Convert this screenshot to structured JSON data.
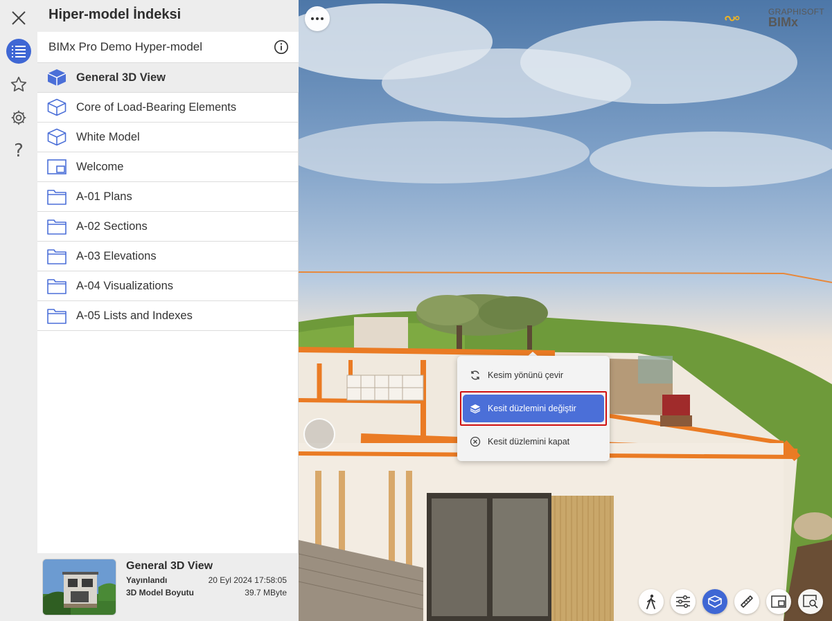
{
  "panel": {
    "title": "Hiper-model İndeksi",
    "model_name": "BIMx Pro Demo Hyper-model"
  },
  "rail": {
    "items": [
      {
        "icon": "close-icon"
      },
      {
        "icon": "list-icon"
      },
      {
        "icon": "star-icon"
      },
      {
        "icon": "gear-icon"
      },
      {
        "icon": "help-icon"
      }
    ],
    "help_glyph": "?"
  },
  "list": {
    "items": [
      {
        "label": "General 3D View",
        "icon": "cube-icon",
        "selected": true
      },
      {
        "label": "Core of Load-Bearing Elements",
        "icon": "cube-outline-icon"
      },
      {
        "label": "White Model",
        "icon": "cube-outline-icon"
      },
      {
        "label": "Welcome",
        "icon": "layout-icon"
      },
      {
        "label": "A-01 Plans",
        "icon": "folder-icon"
      },
      {
        "label": "A-02 Sections",
        "icon": "folder-icon"
      },
      {
        "label": "A-03 Elevations",
        "icon": "folder-icon"
      },
      {
        "label": "A-04 Visualizations",
        "icon": "folder-icon"
      },
      {
        "label": "A-05 Lists and Indexes",
        "icon": "folder-icon"
      }
    ]
  },
  "footer": {
    "title": "General 3D View",
    "published_label": "Yayınlandı",
    "published_value": "20 Eyl 2024 17:58:05",
    "size_label": "3D Model Boyutu",
    "size_value": "39.7 MByte"
  },
  "logo": {
    "line1": "GRAPHISOFT",
    "line2": "BIMx"
  },
  "popup": {
    "items": [
      {
        "label": "Kesim yönünü çevir",
        "icon": "rotate-icon"
      },
      {
        "label": "Kesit düzlemini değiştir",
        "icon": "section-plane-icon",
        "active": true
      },
      {
        "label": "Kesit düzlemini kapat",
        "icon": "close-circle-icon"
      }
    ]
  },
  "toolbar": {
    "items": [
      {
        "icon": "walk-icon"
      },
      {
        "icon": "sliders-icon"
      },
      {
        "icon": "section-box-icon",
        "active": true
      },
      {
        "icon": "ruler-icon"
      },
      {
        "icon": "layout-icon"
      },
      {
        "icon": "zoom-view-icon"
      }
    ]
  },
  "colors": {
    "accent": "#3f67d4",
    "highlight": "#d01010"
  }
}
